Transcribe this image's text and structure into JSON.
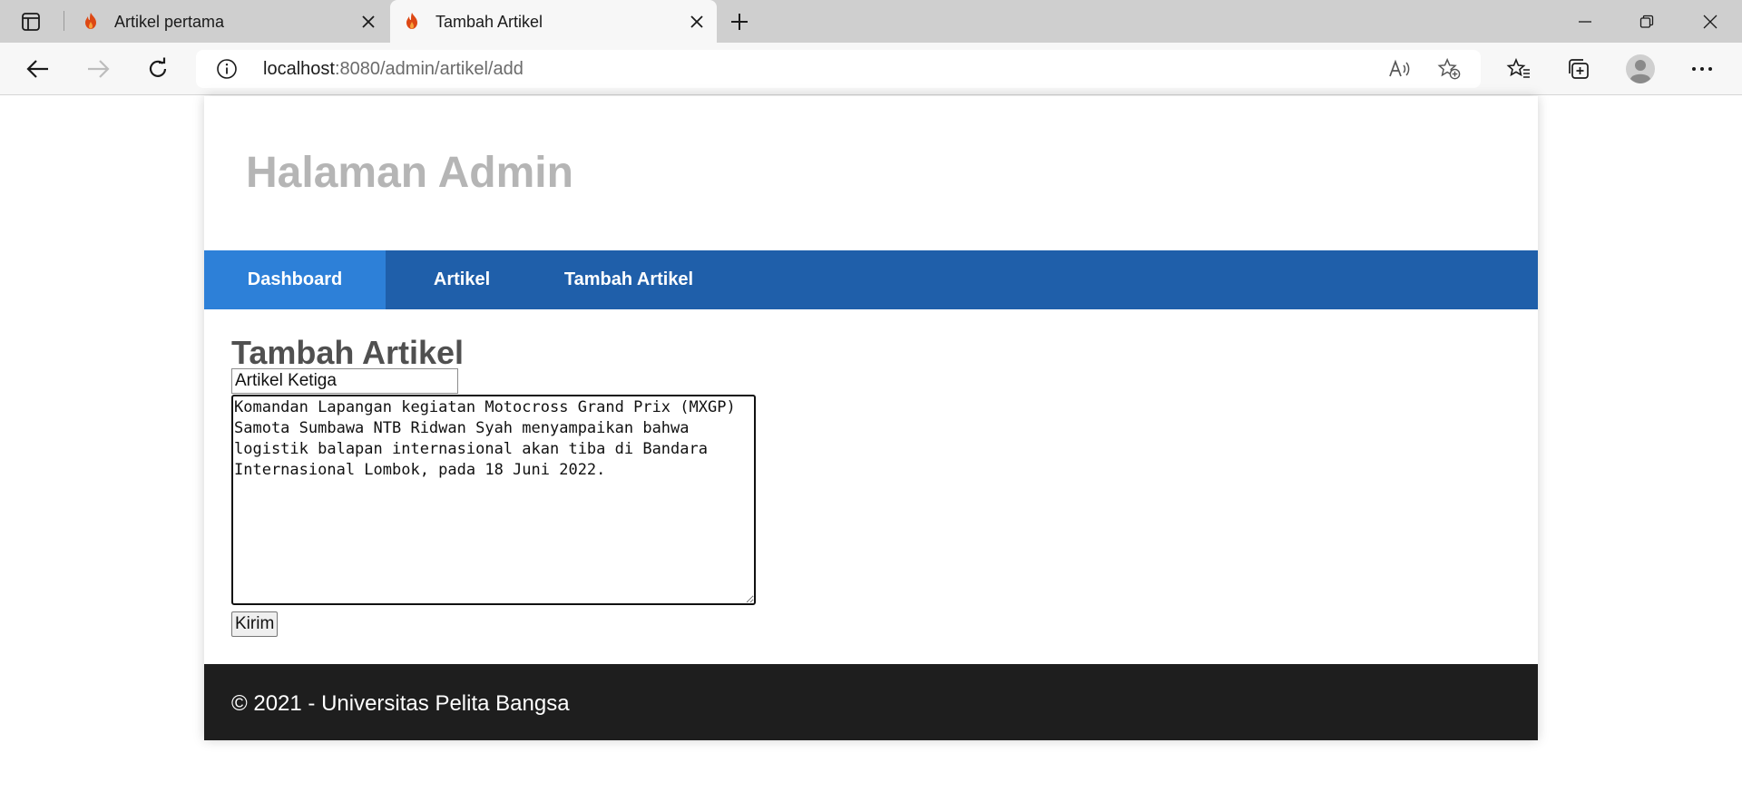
{
  "browser": {
    "tabs": [
      {
        "title": "Artikel pertama",
        "active": false
      },
      {
        "title": "Tambah Artikel",
        "active": true
      }
    ],
    "address": {
      "host": "localhost",
      "rest": ":8080/admin/artikel/add"
    }
  },
  "site": {
    "title": "Halaman Admin",
    "nav": [
      "Dashboard",
      "Artikel",
      "Tambah Artikel"
    ],
    "active_nav": "Dashboard"
  },
  "form": {
    "heading": "Tambah Artikel",
    "title_value": "Artikel Ketiga",
    "body_value": "Komandan Lapangan kegiatan Motocross Grand Prix (MXGP) Samota Sumbawa NTB Ridwan Syah menyampaikan bahwa logistik balapan internasional akan tiba di Bandara Internasional Lombok, pada 18 Juni 2022.",
    "submit_label": "Kirim"
  },
  "footer": {
    "text": "© 2021 - Universitas Pelita Bangsa"
  },
  "colors": {
    "nav_bg": "#1f5faa",
    "nav_active": "#2d80d8",
    "footer_bg": "#1e1e1e",
    "title": "#b5b5b5"
  }
}
